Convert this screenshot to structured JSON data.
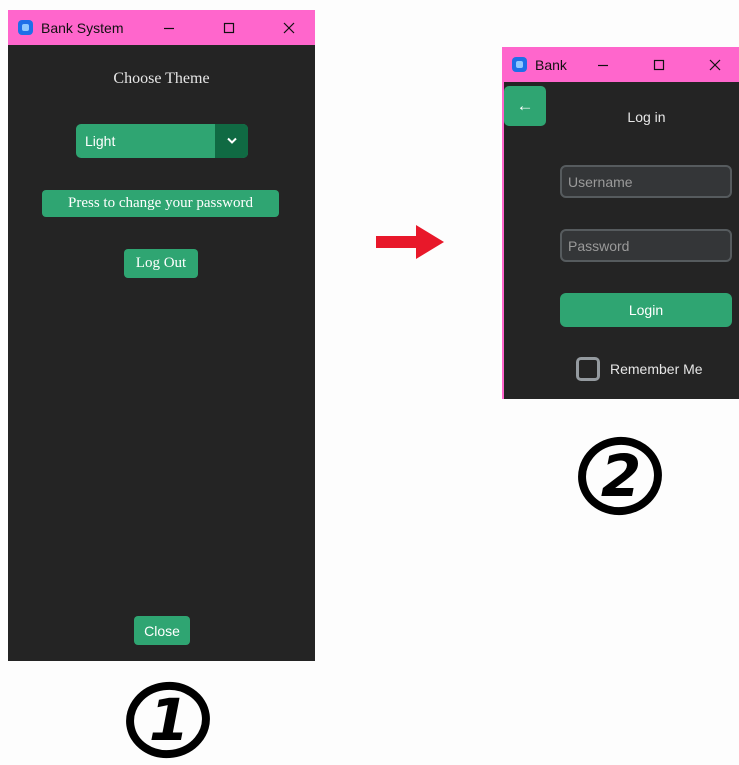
{
  "window1": {
    "title": "Bank System",
    "theme_title": "Choose Theme",
    "theme_value": "Light",
    "change_password_label": "Press to change your password",
    "logout_label": "Log Out",
    "close_label": "Close"
  },
  "window2": {
    "title": "Bank",
    "back_label": "←",
    "login_title": "Log in",
    "username_placeholder": "Username",
    "password_placeholder": "Password",
    "login_label": "Login",
    "remember_label": "Remember Me"
  },
  "badges": {
    "one": "1",
    "two": "2"
  },
  "colors": {
    "titlebar": "#ff66cc",
    "window_bg": "#242424",
    "accent": "#2fa572",
    "accent_dark": "#106a43",
    "arrow": "#e8182a"
  },
  "icons": [
    "app-icon",
    "minimize-icon",
    "maximize-icon",
    "close-icon",
    "chevron-down-icon",
    "arrow-right-icon",
    "back-arrow-icon"
  ]
}
